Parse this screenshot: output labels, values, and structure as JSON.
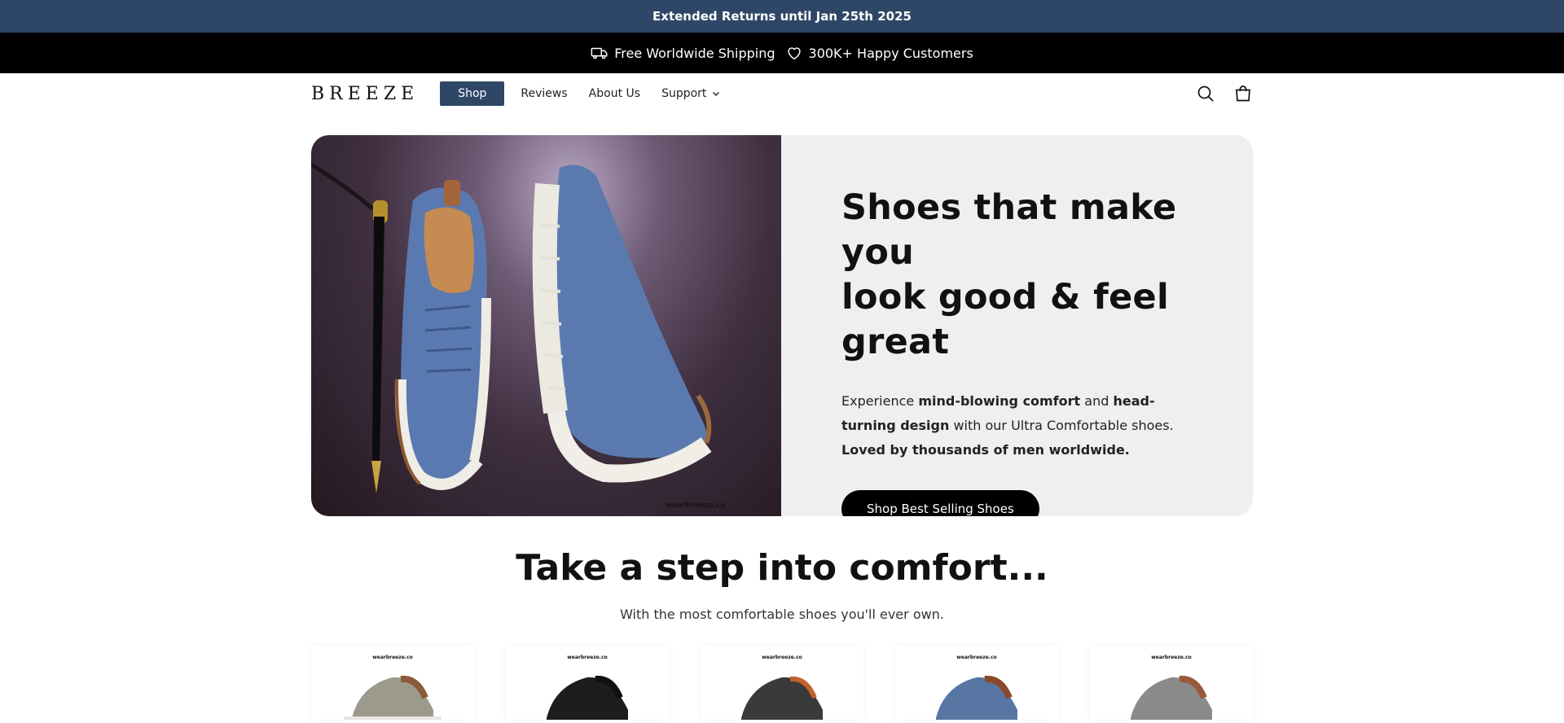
{
  "announcement": {
    "text": "Extended Returns until Jan 25th 2025"
  },
  "announcement_bar": {
    "items": [
      {
        "icon": "truck-icon",
        "label": "Free Worldwide Shipping"
      },
      {
        "icon": "heart-icon",
        "label": "300K+ Happy Customers"
      }
    ]
  },
  "header": {
    "logo": "BREEZE",
    "nav": [
      {
        "label": "Shop",
        "active": true
      },
      {
        "label": "Reviews"
      },
      {
        "label": "About Us"
      },
      {
        "label": "Support",
        "dropdown": true
      }
    ],
    "icons": [
      "search-icon",
      "cart-icon"
    ]
  },
  "hero": {
    "title_line1": "Shoes that make you",
    "title_line2": "look good & feel great",
    "desc": {
      "p1": "Experience ",
      "b1": "mind-blowing comfort",
      "p2": " and ",
      "b2": "head-turning design",
      "p3": " with our Ultra Comfortable shoes. ",
      "b3": "Loved by thousands of men worldwide."
    },
    "cta": "Shop Best Selling Shoes",
    "watermark": "wearbreeze.co"
  },
  "section": {
    "title": "Take a step into comfort...",
    "subtitle": "With the most comfortable shoes you'll ever own."
  },
  "products": [
    {
      "tag": "wearbreeze.co",
      "color": "#9b9a8d",
      "accent": "#8a5a3a"
    },
    {
      "tag": "wearbreeze.co",
      "color": "#1d1d1d",
      "accent": "#111111"
    },
    {
      "tag": "wearbreeze.co",
      "color": "#3a3a3a",
      "accent": "#c4622d"
    },
    {
      "tag": "wearbreeze.co",
      "color": "#5876a3",
      "accent": "#8a4a2a"
    },
    {
      "tag": "wearbreeze.co",
      "color": "#8a8a8a",
      "accent": "#9a5a3a"
    }
  ],
  "colors": {
    "brand_navy": "#2f4766",
    "black": "#000000",
    "hero_bg": "#efefef"
  }
}
